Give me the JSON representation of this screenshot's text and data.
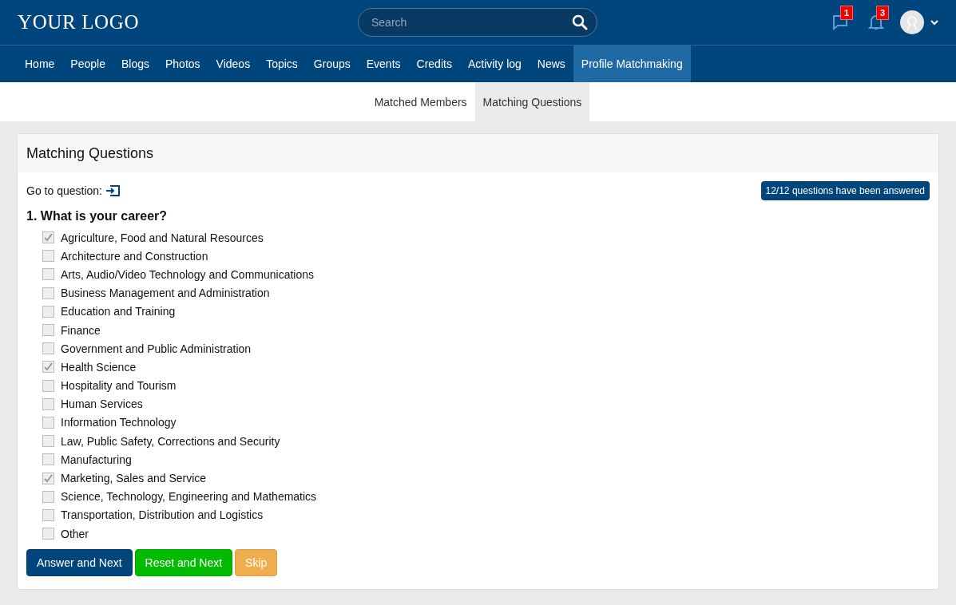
{
  "header": {
    "logo": "YOUR LOGO",
    "search": {
      "placeholder": "Search"
    },
    "messages_badge": "1",
    "notifications_badge": "3"
  },
  "nav": [
    {
      "label": "Home",
      "selected": false
    },
    {
      "label": "People",
      "selected": false
    },
    {
      "label": "Blogs",
      "selected": false
    },
    {
      "label": "Photos",
      "selected": false
    },
    {
      "label": "Videos",
      "selected": false
    },
    {
      "label": "Topics",
      "selected": false
    },
    {
      "label": "Groups",
      "selected": false
    },
    {
      "label": "Events",
      "selected": false
    },
    {
      "label": "Credits",
      "selected": false
    },
    {
      "label": "Activity log",
      "selected": false
    },
    {
      "label": "News",
      "selected": false
    },
    {
      "label": "Profile Matchmaking",
      "selected": true
    }
  ],
  "subtabs": [
    {
      "label": "Matched Members",
      "selected": false
    },
    {
      "label": "Matching Questions",
      "selected": true
    }
  ],
  "panel": {
    "title": "Matching Questions",
    "goto_label": "Go to question:",
    "answered_badge": "12/12 questions have been answered",
    "question": "1. What is your career?",
    "options": [
      {
        "label": "Agriculture, Food and Natural Resources",
        "checked": true
      },
      {
        "label": "Architecture and Construction",
        "checked": false
      },
      {
        "label": "Arts, Audio/Video Technology and Communications",
        "checked": false
      },
      {
        "label": "Business Management and Administration",
        "checked": false
      },
      {
        "label": "Education and Training",
        "checked": false
      },
      {
        "label": "Finance",
        "checked": false
      },
      {
        "label": "Government and Public Administration",
        "checked": false
      },
      {
        "label": "Health Science",
        "checked": true
      },
      {
        "label": "Hospitality and Tourism",
        "checked": false
      },
      {
        "label": "Human Services",
        "checked": false
      },
      {
        "label": "Information Technology",
        "checked": false
      },
      {
        "label": "Law, Public Safety, Corrections and Security",
        "checked": false
      },
      {
        "label": "Manufacturing",
        "checked": false
      },
      {
        "label": "Marketing, Sales and Service",
        "checked": true
      },
      {
        "label": "Science, Technology, Engineering and Mathematics",
        "checked": false
      },
      {
        "label": "Transportation, Distribution and Logistics",
        "checked": false
      },
      {
        "label": "Other",
        "checked": false
      }
    ],
    "buttons": [
      {
        "label": "Answer and Next",
        "kind": "primary"
      },
      {
        "label": "Reset and Next",
        "kind": "success"
      },
      {
        "label": "Skip",
        "kind": "warning"
      }
    ]
  }
}
